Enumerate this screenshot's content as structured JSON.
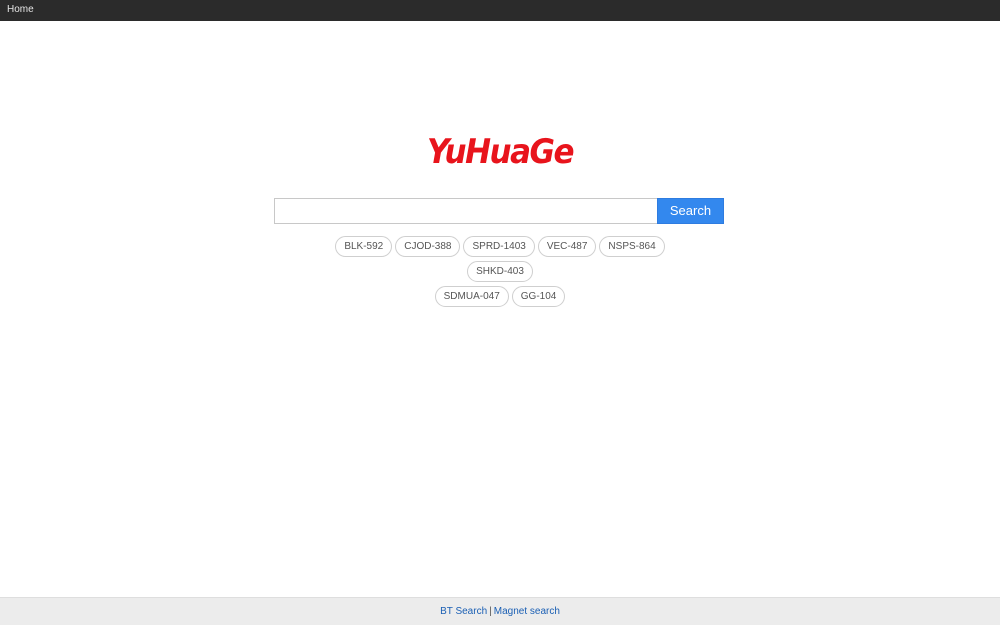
{
  "topbar": {
    "home_label": "Home"
  },
  "logo": {
    "text": "YuHuaGe",
    "color": "#e8141c"
  },
  "search": {
    "placeholder": "",
    "value": "",
    "button_label": "Search",
    "button_color": "#3388ee"
  },
  "tags": [
    "BLK-592",
    "CJOD-388",
    "SPRD-1403",
    "VEC-487",
    "NSPS-864",
    "SHKD-403",
    "SDMUA-047",
    "GG-104"
  ],
  "footer": {
    "link1": "BT Search",
    "separator": "|",
    "link2": "Magnet search"
  }
}
